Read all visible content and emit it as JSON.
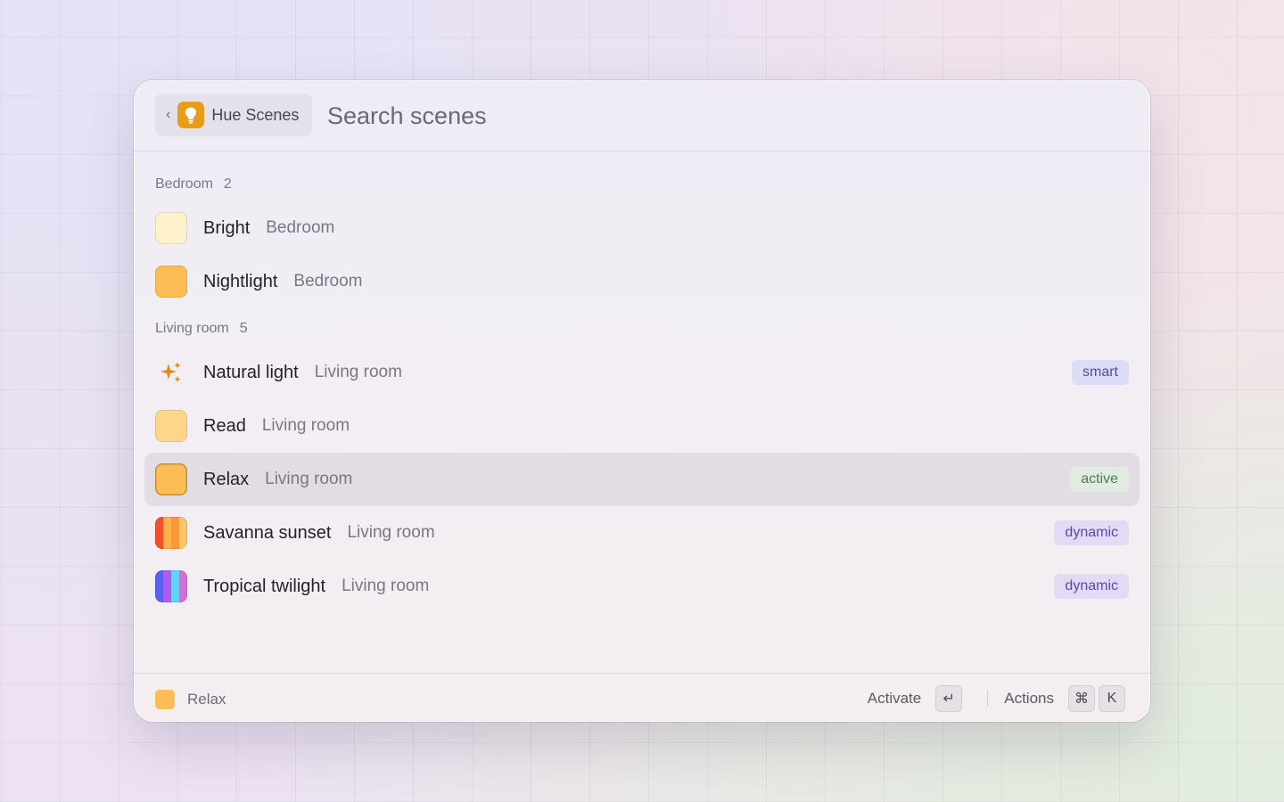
{
  "header": {
    "extension_name": "Hue Scenes",
    "search_placeholder": "Search scenes",
    "search_value": "",
    "icons": {
      "back": "chevron-left-icon",
      "extension": "lightbulb-icon"
    }
  },
  "sections": [
    {
      "title": "Bedroom",
      "count": "2",
      "items": [
        {
          "title": "Bright",
          "subtitle": "Bedroom",
          "icon": "swatch",
          "color": "#fdf1cc",
          "badge": ""
        },
        {
          "title": "Nightlight",
          "subtitle": "Bedroom",
          "icon": "swatch",
          "color": "#fdbd56",
          "badge": ""
        }
      ]
    },
    {
      "title": "Living room",
      "count": "5",
      "items": [
        {
          "title": "Natural light",
          "subtitle": "Living room",
          "icon": "sparkle-icon",
          "color": "#d9900f",
          "badge": "smart"
        },
        {
          "title": "Read",
          "subtitle": "Living room",
          "icon": "swatch",
          "color": "#fed689",
          "badge": ""
        },
        {
          "title": "Relax",
          "subtitle": "Living room",
          "icon": "swatch",
          "color": "#fdbd56",
          "badge": "active",
          "selected": true
        },
        {
          "title": "Savanna sunset",
          "subtitle": "Living room",
          "icon": "striped-swatch",
          "colors": [
            "#f24f2a",
            "#fbb148",
            "#f99a3a",
            "#fcc766"
          ],
          "badge": "dynamic"
        },
        {
          "title": "Tropical twilight",
          "subtitle": "Living room",
          "icon": "striped-swatch",
          "colors": [
            "#5b5ff2",
            "#b05bf0",
            "#62d4f2",
            "#d96ad9"
          ],
          "badge": "dynamic"
        }
      ]
    }
  ],
  "footer": {
    "selected_label": "Relax",
    "selected_color": "#fdbd56",
    "primary_action": "Activate",
    "primary_key": "↵",
    "secondary_action": "Actions",
    "secondary_keys": [
      "⌘",
      "K"
    ]
  }
}
